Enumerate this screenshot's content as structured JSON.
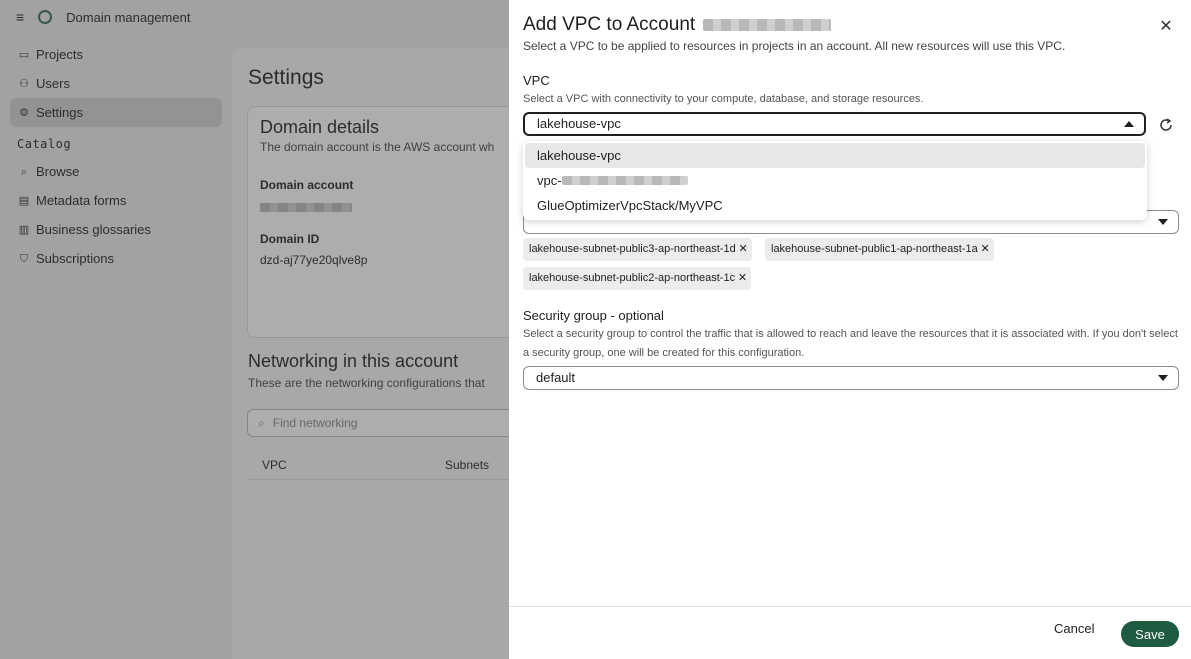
{
  "app": {
    "title": "Domain management",
    "sidebar": {
      "items": [
        {
          "label": "Projects",
          "icon": "folder-icon"
        },
        {
          "label": "Users",
          "icon": "users-icon"
        },
        {
          "label": "Settings",
          "icon": "gear-icon",
          "active": true
        }
      ],
      "section": "Catalog",
      "catalog_items": [
        {
          "label": "Browse",
          "icon": "search-icon"
        },
        {
          "label": "Metadata forms",
          "icon": "form-icon"
        },
        {
          "label": "Business glossaries",
          "icon": "book-icon"
        },
        {
          "label": "Subscriptions",
          "icon": "shield-icon"
        }
      ]
    },
    "page_title": "Settings",
    "domain_card": {
      "title": "Domain details",
      "description": "The domain account is the AWS account wh",
      "account_label": "Domain account",
      "domain_id_label": "Domain ID",
      "domain_id": "dzd-aj77ye20qlve8p"
    },
    "networking": {
      "title": "Networking in this account",
      "description": "These are the networking configurations that",
      "search_placeholder": "Find networking",
      "columns": [
        "VPC",
        "Subnets"
      ]
    }
  },
  "drawer": {
    "title": "Add VPC to Account",
    "subtitle": "Select a VPC to be applied to resources in projects in an account. All new resources will use this VPC.",
    "vpc": {
      "label": "VPC",
      "help": "Select a VPC with connectivity to your compute, database, and storage resources.",
      "value": "lakehouse-vpc",
      "options": [
        "lakehouse-vpc",
        "vpc-",
        "GlueOptimizerVpcStack/MyVPC"
      ]
    },
    "subnets": {
      "tags": [
        "lakehouse-subnet-public3-ap-northeast-1d",
        "lakehouse-subnet-public1-ap-northeast-1a",
        "lakehouse-subnet-public2-ap-northeast-1c"
      ]
    },
    "security_group": {
      "label": "Security group - optional",
      "help": "Select a security group to control the traffic that is allowed to reach and leave the resources that it is associated with. If you don't select a security group, one will be created for this configuration.",
      "value": "default"
    },
    "cancel_label": "Cancel",
    "save_label": "Save"
  },
  "colors": {
    "primary": "#1f5b40",
    "overlay": "rgba(60,60,60,0.42)"
  }
}
